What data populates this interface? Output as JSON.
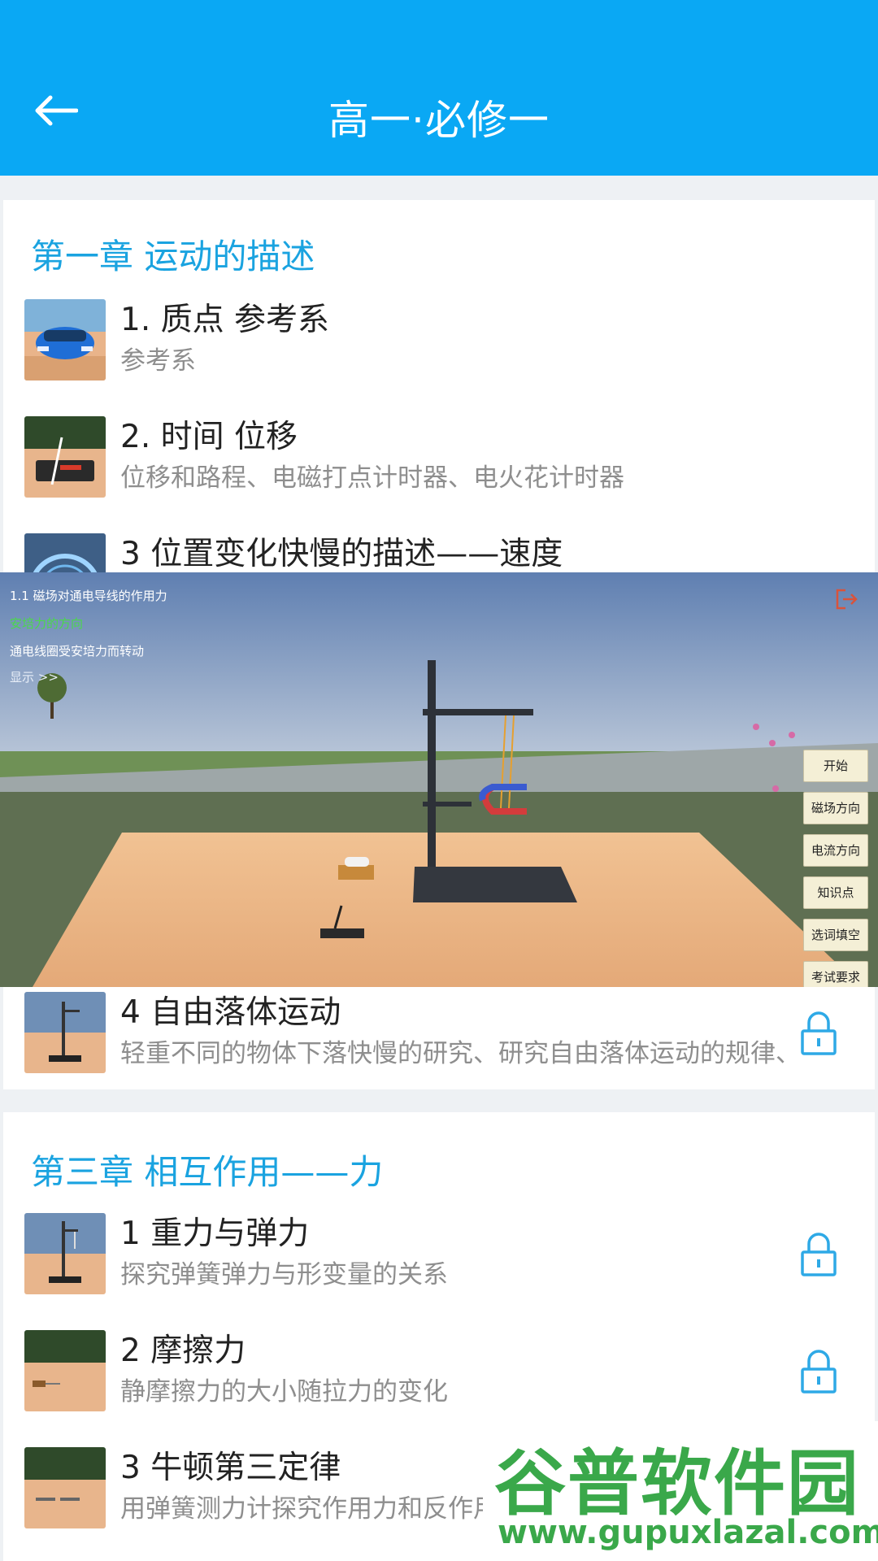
{
  "header": {
    "title": "高一·必修一",
    "back_icon": "arrow-left-icon"
  },
  "chapter1": {
    "title": "第一章 运动的描述",
    "lessons": [
      {
        "title": "1. 质点 参考系",
        "desc": "参考系"
      },
      {
        "title": "2. 时间 位移",
        "desc": "位移和路程、电磁打点计时器、电火花计时器"
      },
      {
        "title": "3 位置变化快慢的描述——速度",
        "desc": ""
      }
    ]
  },
  "chapter2": {
    "lessons": [
      {
        "title": "4 自由落体运动",
        "desc": "轻重不同的物体下落快慢的研究、研究自由落体运动的规律、"
      }
    ]
  },
  "chapter3": {
    "title": "第三章 相互作用——力",
    "lessons": [
      {
        "title": "1 重力与弹力",
        "desc": "探究弹簧弹力与形变量的关系"
      },
      {
        "title": "2 摩擦力",
        "desc": "静摩擦力的大小随拉力的变化"
      },
      {
        "title": "3 牛顿第三定律",
        "desc": "用弹簧测力计探究作用力和反作用力的关系"
      }
    ]
  },
  "scene": {
    "lesson_title": "1.1 磁场对通电导线的作用力",
    "current_topic": "安培力的方向",
    "topic_2": "通电线圈受安培力而转动",
    "show_link": "显示 >>",
    "buttons": [
      "开始",
      "磁场方向",
      "电流方向",
      "知识点",
      "选词填空",
      "考试要求"
    ]
  },
  "watermark": {
    "brand": "谷普软件园",
    "url": "www.gupuxlazal.com"
  },
  "colors": {
    "header": "#0aa8f4",
    "chapter": "#1aa3e0",
    "lock": "#2ea9e6",
    "topic_green": "#4bd84b",
    "watermark": "#3aa84a"
  }
}
